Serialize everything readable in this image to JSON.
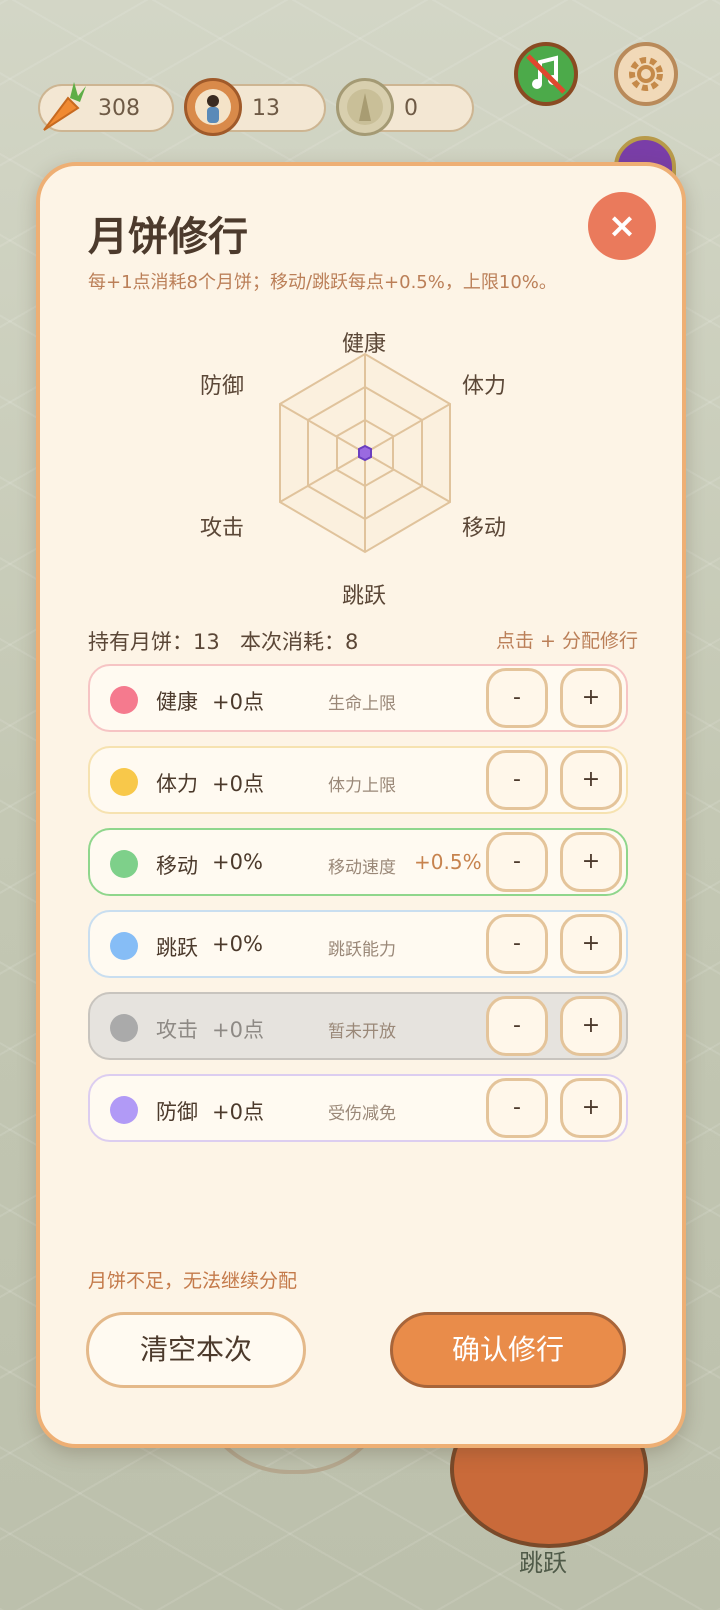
{
  "hud": {
    "carrot_count": "308",
    "mooncake_count": "13",
    "coin_count": "0"
  },
  "background": {
    "jump_label": "跳跃"
  },
  "modal": {
    "title": "月饼修行",
    "close_label": "×",
    "subtitle": "每+1点消耗8个月饼；移动/跳跃每点+0.5%，上限10%。",
    "radar": {
      "labels": {
        "health": "健康",
        "stamina": "体力",
        "move": "移动",
        "jump": "跳跃",
        "attack": "攻击",
        "defense": "防御"
      }
    },
    "stats": {
      "held_text": "持有月饼：13",
      "cost_text": "本次消耗：8",
      "hint": "点击 + 分配修行"
    },
    "rows": [
      {
        "name": "健康",
        "amount": "+0点",
        "desc": "生命上限",
        "bonus": "",
        "color": "#f57a8e",
        "border": "#f6c4c4"
      },
      {
        "name": "体力",
        "amount": "+0点",
        "desc": "体力上限",
        "bonus": "",
        "color": "#f8c84a",
        "border": "#f6e2b0"
      },
      {
        "name": "移动",
        "amount": "+0%",
        "desc": "移动速度",
        "bonus": "+0.5%",
        "color": "#7ed08a",
        "border": "#8fd68c"
      },
      {
        "name": "跳跃",
        "amount": "+0%",
        "desc": "跳跃能力",
        "bonus": "",
        "color": "#86bdf6",
        "border": "#c9def0"
      },
      {
        "name": "攻击",
        "amount": "+0点",
        "desc": "暂未开放",
        "bonus": "",
        "color": "#aaaaaa",
        "border": "#c8c4be"
      },
      {
        "name": "防御",
        "amount": "+0点",
        "desc": "受伤减免",
        "bonus": "",
        "color": "#b19af6",
        "border": "#dccdf0"
      }
    ],
    "button_minus": "-",
    "button_plus": "+",
    "warning": "月饼不足，无法继续分配",
    "clear_label": "清空本次",
    "confirm_label": "确认修行"
  }
}
